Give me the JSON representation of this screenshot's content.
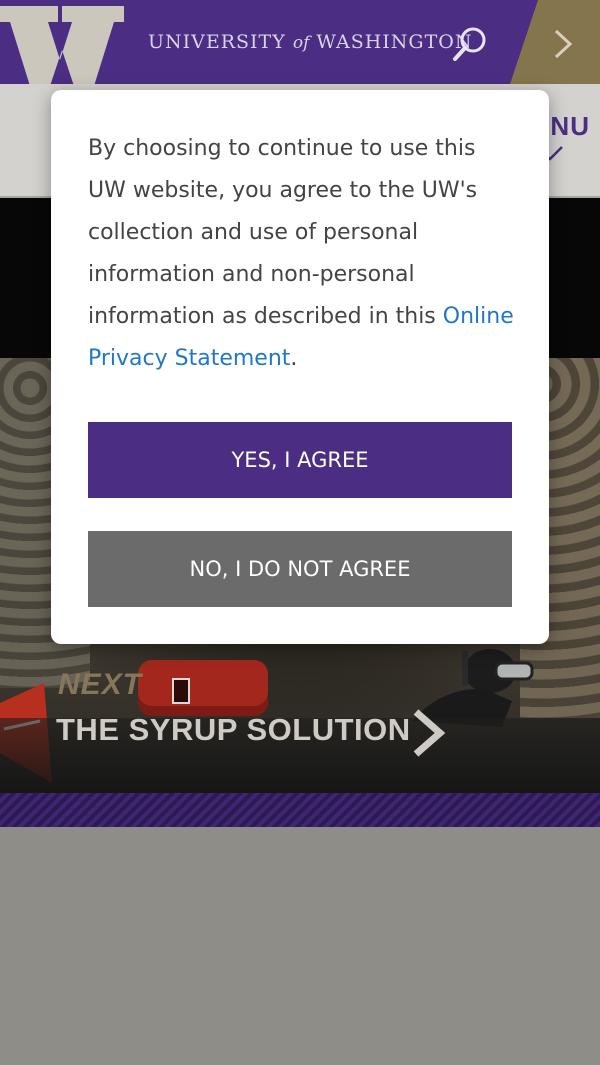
{
  "header": {
    "logo_letter": "W",
    "university_name_pre": "UNIVERSITY ",
    "university_name_of": "of",
    "university_name_post": " WASHINGTON",
    "search_icon": "search-icon",
    "next_icon": "chevron-right-icon"
  },
  "subnav": {
    "menu_label": "ENU",
    "menu_icon": "chevron-down-icon"
  },
  "hero": {
    "next_label": "NEXT",
    "story_title": "THE SYRUP SOLUTION",
    "arrow_icon": "chevron-right-icon"
  },
  "consent_modal": {
    "body_text": "By choosing to continue to use this UW website, you agree to the UW's collection and use of personal information and non-personal information as described in this",
    "link_text": "Online Privacy Statement",
    "link_suffix": ".",
    "agree_label": "YES, I AGREE",
    "disagree_label": "NO, I DO NOT AGREE"
  },
  "colors": {
    "uw_purple": "#4b2e83",
    "uw_gold": "#85754d",
    "link_blue": "#1f77c9",
    "disagree_gray": "#6b6b6b"
  }
}
